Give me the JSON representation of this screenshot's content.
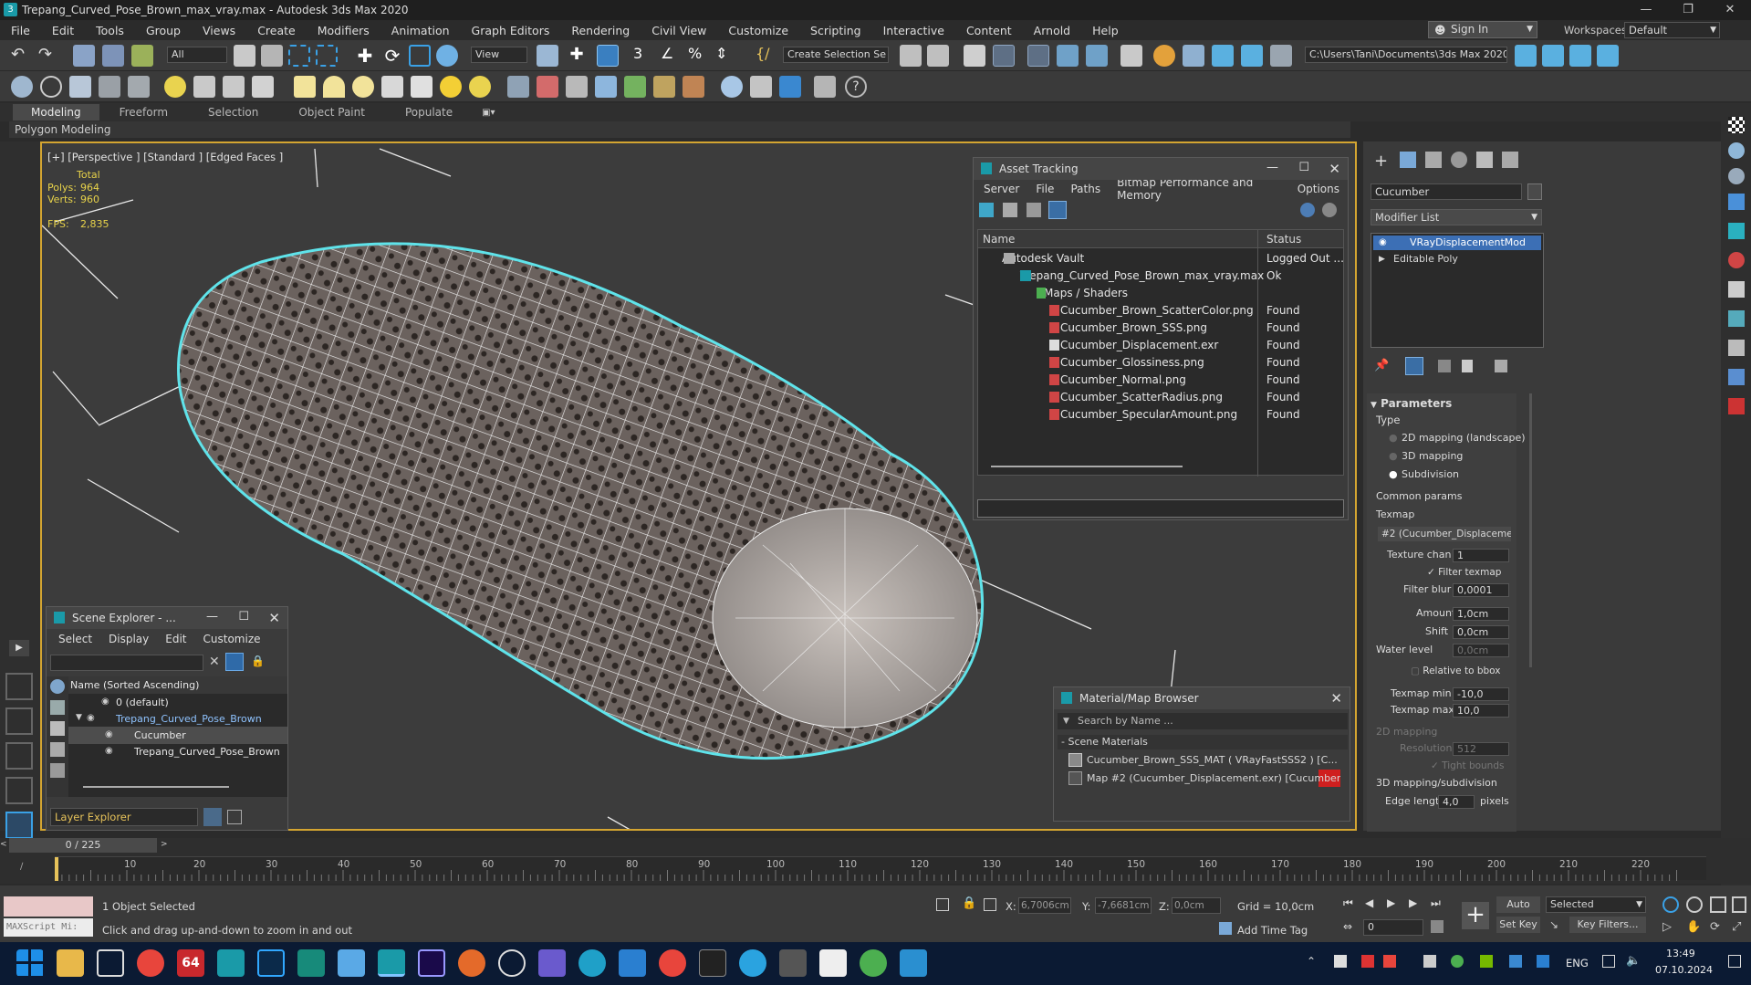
{
  "window": {
    "title": "Trepang_Curved_Pose_Brown_max_vray.max - Autodesk 3ds Max 2020"
  },
  "menu": [
    "File",
    "Edit",
    "Tools",
    "Group",
    "Views",
    "Create",
    "Modifiers",
    "Animation",
    "Graph Editors",
    "Rendering",
    "Civil View",
    "Customize",
    "Scripting",
    "Interactive",
    "Content",
    "Arnold",
    "Help"
  ],
  "account": {
    "sign_in": "Sign In",
    "workspaces_label": "Workspaces:",
    "workspace": "Default"
  },
  "toolbar": {
    "selection_filter": "All",
    "reference_coord": "View",
    "named_selection": "Create Selection Se",
    "project_path": "C:\\Users\\Tani\\Documents\\3ds Max 2020"
  },
  "ribbon": {
    "tabs": [
      "Modeling",
      "Freeform",
      "Selection",
      "Object Paint",
      "Populate"
    ],
    "subtab": "Polygon Modeling"
  },
  "viewport": {
    "label": "[+] [Perspective ] [Standard ] [Edged Faces ]",
    "stats": {
      "total": "Total",
      "polys_label": "Polys:",
      "polys": "964",
      "verts_label": "Verts:",
      "verts": "960",
      "fps_label": "FPS:",
      "fps": "2,835"
    }
  },
  "asset_tracking": {
    "title": "Asset Tracking",
    "menu": [
      "Server",
      "File",
      "Paths",
      "Bitmap Performance and Memory",
      "Options"
    ],
    "col_name": "Name",
    "col_status": "Status",
    "rows": [
      {
        "name": "Autodesk Vault",
        "status": "Logged Out ..."
      },
      {
        "name": "Trepang_Curved_Pose_Brown_max_vray.max",
        "status": "Ok"
      },
      {
        "name": "Maps / Shaders",
        "status": ""
      },
      {
        "name": "Cucumber_Brown_ScatterColor.png",
        "status": "Found"
      },
      {
        "name": "Cucumber_Brown_SSS.png",
        "status": "Found"
      },
      {
        "name": "Cucumber_Displacement.exr",
        "status": "Found"
      },
      {
        "name": "Cucumber_Glossiness.png",
        "status": "Found"
      },
      {
        "name": "Cucumber_Normal.png",
        "status": "Found"
      },
      {
        "name": "Cucumber_ScatterRadius.png",
        "status": "Found"
      },
      {
        "name": "Cucumber_SpecularAmount.png",
        "status": "Found"
      }
    ]
  },
  "scene_explorer": {
    "title": "Scene Explorer - ...",
    "menu": [
      "Select",
      "Display",
      "Edit",
      "Customize"
    ],
    "col_name": "Name (Sorted Ascending)",
    "rows": [
      "0 (default)",
      "Trepang_Curved_Pose_Brown",
      "Cucumber",
      "Trepang_Curved_Pose_Brown"
    ],
    "footer": "Layer Explorer"
  },
  "material_browser": {
    "title": "Material/Map Browser",
    "search": "Search by Name ...",
    "group": "- Scene Materials",
    "items": [
      "Cucumber_Brown_SSS_MAT  ( VRayFastSSS2 )  [C...",
      "Map #2 (Cucumber_Displacement.exr)  [Cucumber]"
    ]
  },
  "command_panel": {
    "object_name": "Cucumber",
    "modifier_list": "Modifier List",
    "stack": [
      "VRayDisplacementMod",
      "Editable Poly"
    ],
    "params_title": "Parameters",
    "type_label": "Type",
    "types": [
      "2D mapping (landscape)",
      "3D mapping",
      "Subdivision"
    ],
    "common": "Common params",
    "texmap_label": "Texmap",
    "texmap": "#2 (Cucumber_Displacement.",
    "texture_chan_label": "Texture chan",
    "texture_chan": "1",
    "filter_texmap": "Filter texmap",
    "filter_blur_label": "Filter blur",
    "filter_blur": "0,0001",
    "amount_label": "Amount",
    "amount": "1,0cm",
    "shift_label": "Shift",
    "shift": "0,0cm",
    "water_label": "Water level",
    "water": "0,0cm",
    "relative": "Relative to bbox",
    "texmap_min_label": "Texmap min",
    "texmap_min": "-10,0",
    "texmap_max_label": "Texmap max",
    "texmap_max": "10,0",
    "mapping2d": "2D mapping",
    "resolution_label": "Resolution",
    "resolution": "512",
    "tight": "Tight bounds",
    "mapping3d": "3D mapping/subdivision",
    "edge_label": "Edge length",
    "edge": "4,0",
    "pixels": "pixels"
  },
  "timeline": {
    "frame": "0 / 225",
    "ticks": [
      "10",
      "20",
      "30",
      "40",
      "50",
      "60",
      "70",
      "80",
      "90",
      "100",
      "110",
      "120",
      "130",
      "140",
      "150",
      "160",
      "170",
      "180",
      "190",
      "200",
      "210",
      "220"
    ]
  },
  "status": {
    "selected": "1 Object Selected",
    "hint": "Click and drag up-and-down to zoom in and out",
    "maxscript": "MAXScript Mi:",
    "x_label": "X:",
    "x": "6,7006cm",
    "y_label": "Y:",
    "y": "-7,6681cm",
    "z_label": "Z:",
    "z": "0,0cm",
    "grid": "Grid = 10,0cm",
    "add_time_tag": "Add Time Tag",
    "auto_key": "Auto Key",
    "set_key": "Set Key",
    "selected_dd": "Selected",
    "key_filters": "Key Filters...",
    "frame_field": "0"
  },
  "taskbar": {
    "lang": "ENG",
    "time": "13:49",
    "date": "07.10.2024",
    "badge": "64"
  }
}
